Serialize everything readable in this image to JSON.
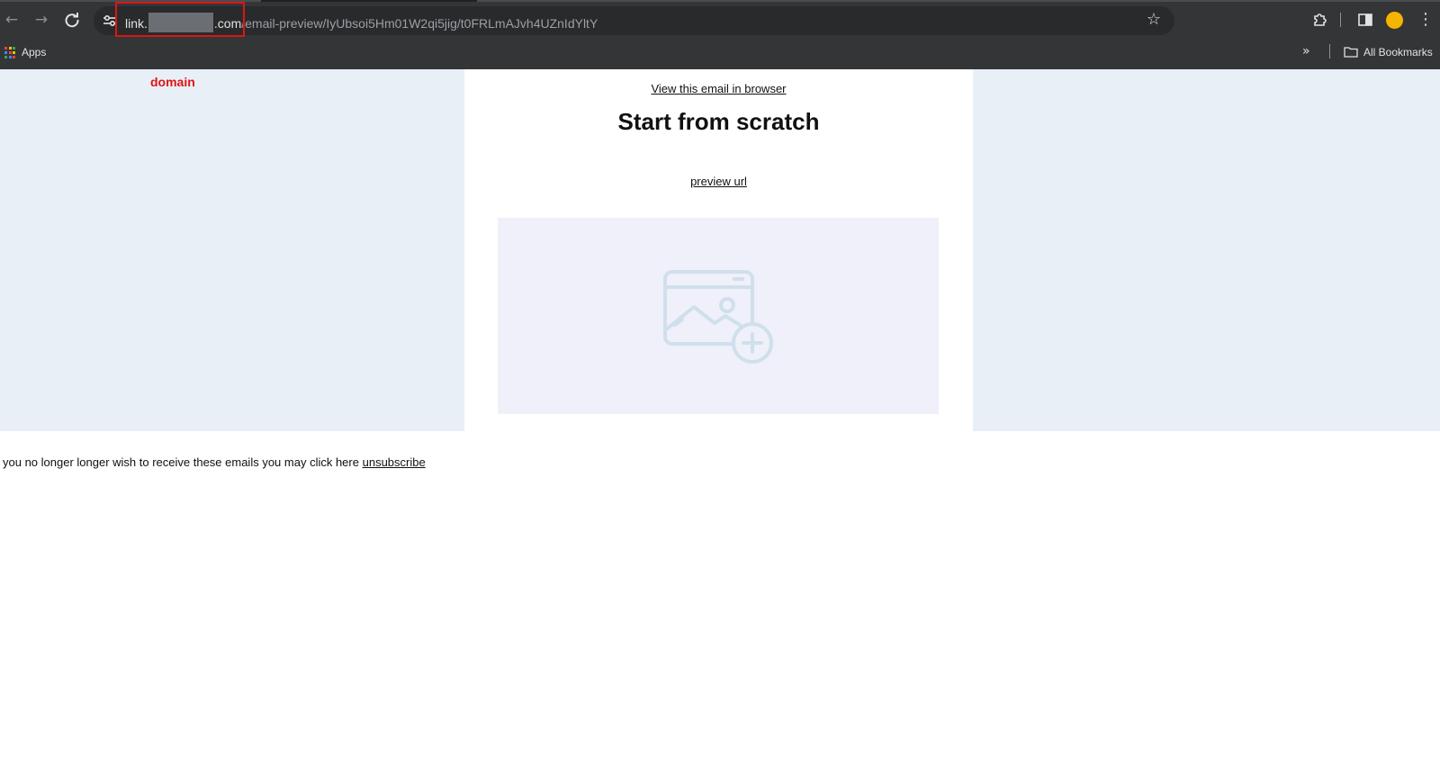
{
  "browser": {
    "address_bar": {
      "url_prefix": "link.",
      "url_domain_suffix": ".com",
      "url_path": "/email-preview/IyUbsoi5Hm01W2qi5jig/t0FRLmAJvh4UZnIdYltY"
    },
    "icons": {
      "back": "back-arrow-icon",
      "forward": "forward-arrow-icon",
      "reload": "reload-icon",
      "site_info": "tune-icon",
      "bookmark": "star-icon",
      "extensions": "puzzle-icon",
      "side_panel": "side-panel-icon",
      "profile": "avatar",
      "menu": "kebab-menu-icon"
    },
    "bookmarks_bar": {
      "apps_label": "Apps",
      "overflow": "»",
      "all_bookmarks_label": "All Bookmarks"
    }
  },
  "annotation": {
    "label": "domain",
    "color": "#e01414"
  },
  "email": {
    "view_in_browser": "View this email in browser",
    "headline": "Start from scratch",
    "preview_link": "preview url",
    "image_placeholder_icon": "image-add-icon",
    "background_color": "#e8eff7"
  },
  "footer": {
    "text": "you no longer longer wish to receive these emails you may click here",
    "unsubscribe_link": "unsubscribe"
  }
}
